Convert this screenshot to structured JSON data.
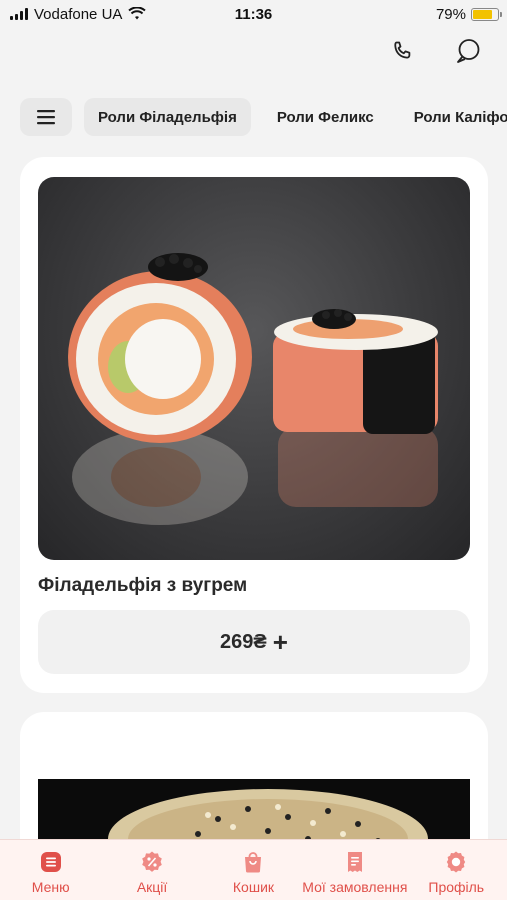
{
  "status_bar": {
    "carrier": "Vodafone UA",
    "time": "11:36",
    "battery": "79%",
    "battery_level": 0.79
  },
  "top_actions": {
    "icons": [
      "phone-icon",
      "chat-icon"
    ]
  },
  "tabs": {
    "menu_icon": "hamburger-icon",
    "items": [
      {
        "label": "Роли Філадельфія",
        "active": true
      },
      {
        "label": "Роли Феликс",
        "active": false
      },
      {
        "label": "Роли Каліфорн",
        "active": false
      }
    ]
  },
  "products": [
    {
      "name": "Філадельфія з вугрем",
      "price": "269₴"
    }
  ],
  "bottom_nav": {
    "accent_color": "#e0504a",
    "items": [
      {
        "label": "Меню",
        "icon": "menu-list-icon"
      },
      {
        "label": "Акції",
        "icon": "discount-icon"
      },
      {
        "label": "Кошик",
        "icon": "bag-icon"
      },
      {
        "label": "Мої замовлення",
        "icon": "receipt-icon"
      },
      {
        "label": "Профіль",
        "icon": "profile-icon"
      }
    ]
  }
}
